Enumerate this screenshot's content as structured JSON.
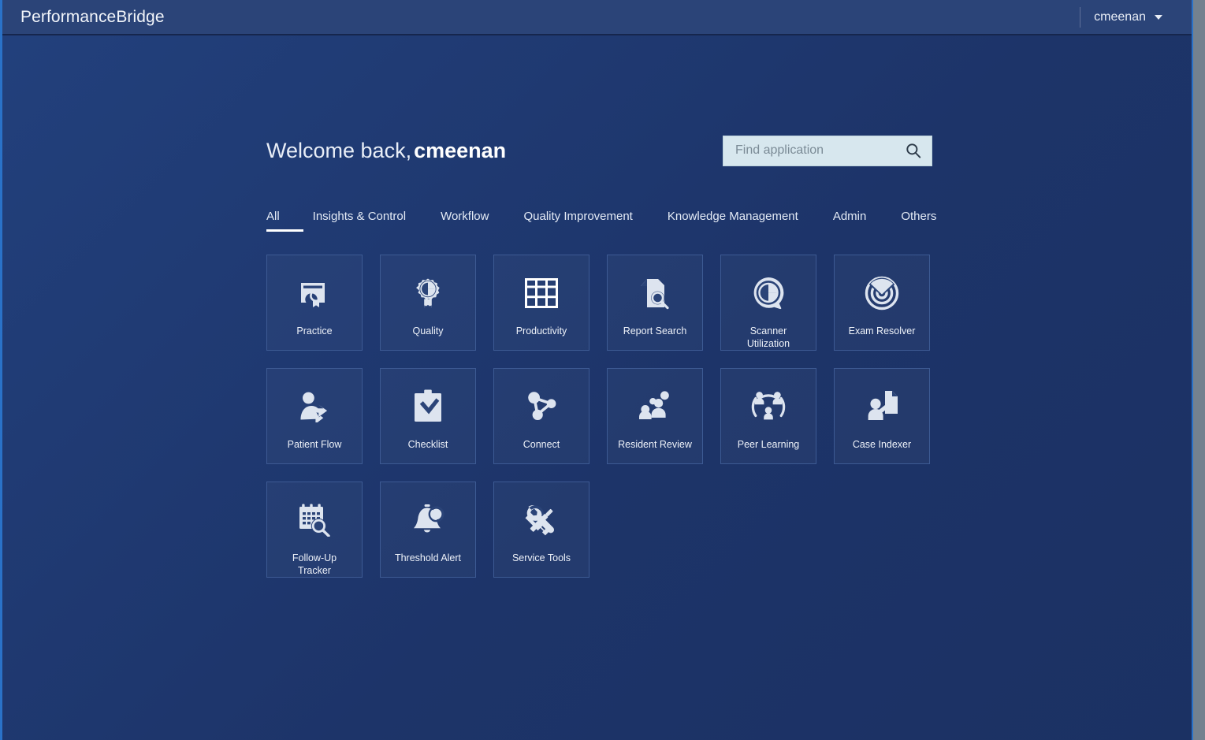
{
  "header": {
    "brand": "PerformanceBridge",
    "user_name": "cmeenan",
    "caret_icon": "chevron-down-icon"
  },
  "welcome": {
    "greeting": "Welcome back,",
    "user_name": "cmeenan"
  },
  "search": {
    "placeholder": "Find application",
    "value": "",
    "icon": "search-icon"
  },
  "tabs": [
    {
      "label": "All",
      "active": true
    },
    {
      "label": "Insights & Control",
      "active": false
    },
    {
      "label": "Workflow",
      "active": false
    },
    {
      "label": "Quality Improvement",
      "active": false
    },
    {
      "label": "Knowledge Management",
      "active": false
    },
    {
      "label": "Admin",
      "active": false
    },
    {
      "label": "Others",
      "active": false
    }
  ],
  "tiles": [
    {
      "label": "Practice",
      "icon": "certificate-award-icon"
    },
    {
      "label": "Quality",
      "icon": "pie-chart-medal-icon"
    },
    {
      "label": "Productivity",
      "icon": "grid-table-icon"
    },
    {
      "label": "Report Search",
      "icon": "document-search-icon"
    },
    {
      "label": "Scanner\nUtilization",
      "icon": "pie-gauge-ring-icon"
    },
    {
      "label": "Exam Resolver",
      "icon": "bullseye-target-icon"
    },
    {
      "label": "Patient Flow",
      "icon": "person-arrow-icon"
    },
    {
      "label": "Checklist",
      "icon": "clipboard-check-icon"
    },
    {
      "label": "Connect",
      "icon": "network-nodes-icon"
    },
    {
      "label": "Resident Review",
      "icon": "people-chat-icon"
    },
    {
      "label": "Peer Learning",
      "icon": "people-circle-icon"
    },
    {
      "label": "Case Indexer",
      "icon": "person-document-icon"
    },
    {
      "label": "Follow-Up\nTracker",
      "icon": "calendar-search-icon"
    },
    {
      "label": "Threshold Alert",
      "icon": "bell-alert-icon"
    },
    {
      "label": "Service Tools",
      "icon": "wrench-screwdriver-icon"
    }
  ],
  "colors": {
    "page_background": "#1d3469",
    "header_background": "#2b4478",
    "accent_border": "#2a72c8",
    "tile_border": "#3d5a93",
    "search_background": "#d7e7ee",
    "icon_fill": "#dde4ef",
    "text_primary": "#eef2f9"
  }
}
